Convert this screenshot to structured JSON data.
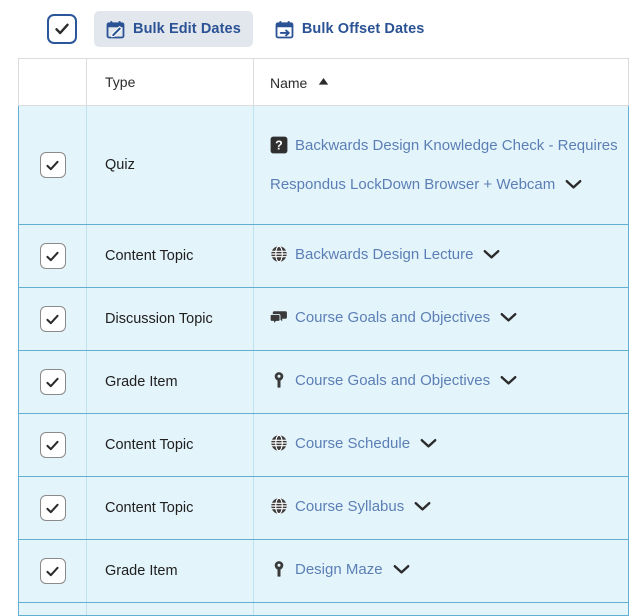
{
  "toolbar": {
    "select_all_checkbox": {
      "icon": "checkmark-icon",
      "checked": true
    },
    "buttons": [
      {
        "label": "Bulk Edit Dates",
        "icon": "calendar-edit-icon",
        "active": true
      },
      {
        "label": "Bulk Offset Dates",
        "icon": "calendar-offset-icon",
        "active": false
      }
    ]
  },
  "table": {
    "columns": [
      {
        "key": "select",
        "label": ""
      },
      {
        "key": "type",
        "label": "Type"
      },
      {
        "key": "name",
        "label": "Name"
      }
    ],
    "sort": {
      "column": "Name",
      "direction": "ascending",
      "icon": "caret-up-icon"
    },
    "rows": [
      {
        "selected": true,
        "type": "Quiz",
        "name": "Backwards Design Knowledge Check - Requires Respondus LockDown Browser + Webcam",
        "icon": "quiz-question-icon",
        "menu_icon": "chevron-down-icon"
      },
      {
        "selected": true,
        "type": "Content Topic",
        "name": "Backwards Design Lecture",
        "icon": "globe-icon",
        "menu_icon": "chevron-down-icon"
      },
      {
        "selected": true,
        "type": "Discussion Topic",
        "name": "Course Goals and Objectives",
        "icon": "discussion-bubbles-icon",
        "menu_icon": "chevron-down-icon"
      },
      {
        "selected": true,
        "type": "Grade Item",
        "name": "Course Goals and Objectives",
        "icon": "grade-key-icon",
        "menu_icon": "chevron-down-icon"
      },
      {
        "selected": true,
        "type": "Content Topic",
        "name": "Course Schedule",
        "icon": "globe-icon",
        "menu_icon": "chevron-down-icon"
      },
      {
        "selected": true,
        "type": "Content Topic",
        "name": "Course Syllabus",
        "icon": "globe-icon",
        "menu_icon": "chevron-down-icon"
      },
      {
        "selected": true,
        "type": "Grade Item",
        "name": "Design Maze",
        "icon": "grade-key-icon",
        "menu_icon": "chevron-down-icon"
      }
    ]
  },
  "colors": {
    "link": "#5b7fb5",
    "accent": "#2a5294",
    "row_selected_bg": "#e4f4fb",
    "row_selected_border": "#62afd4",
    "checkbox_border": "#2b579a",
    "icon_dark": "#2b2b2b"
  }
}
